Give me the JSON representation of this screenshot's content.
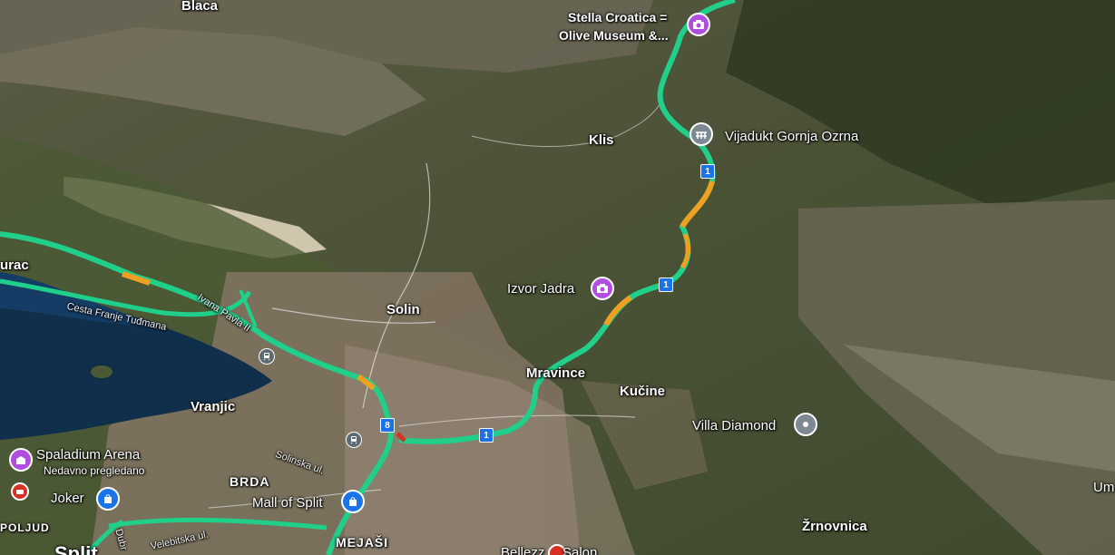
{
  "places": {
    "blaca": "Blaca",
    "stella": "Stella Croatica =",
    "stella2": "Olive Museum &...",
    "klis": "Klis",
    "vijadukt": "Vijadukt Gornja Ozrna",
    "izvor": "Izvor Jadra",
    "solin": "Solin",
    "mravince": "Mravince",
    "kucine": "Kučine",
    "villa": "Villa Diamond",
    "vranjic": "Vranjic",
    "spaladium": "Spaladium Arena",
    "spaladium_sub": "Nedavno pregledano",
    "joker": "Joker",
    "brda": "BRDA",
    "mall": "Mall of Split",
    "mejasi": "MEJAŠI",
    "znjovnica": "Žrnovnica",
    "poljud": "POLJUD",
    "urac": "urac",
    "um": "Um",
    "split": "Split",
    "bellezza": "Bellezz",
    "salon": "Salon"
  },
  "roads": {
    "cesta": "Cesta Franje Tuđmana",
    "ivana": "Ivana Pavla II",
    "solinska": "Solinska ul.",
    "velebitska": "Velebitska ul.",
    "dubrovacka": "Dubr"
  },
  "shields": {
    "s1a": "1",
    "s1b": "1",
    "s1c": "1",
    "s8": "8"
  },
  "colors": {
    "traffic_green": "#1fcf8a",
    "traffic_orange": "#f0a020",
    "traffic_red": "#d93025",
    "poi_purple": "#b04ee0",
    "poi_blue": "#1a73e8",
    "poi_gray": "#7d8a93"
  }
}
